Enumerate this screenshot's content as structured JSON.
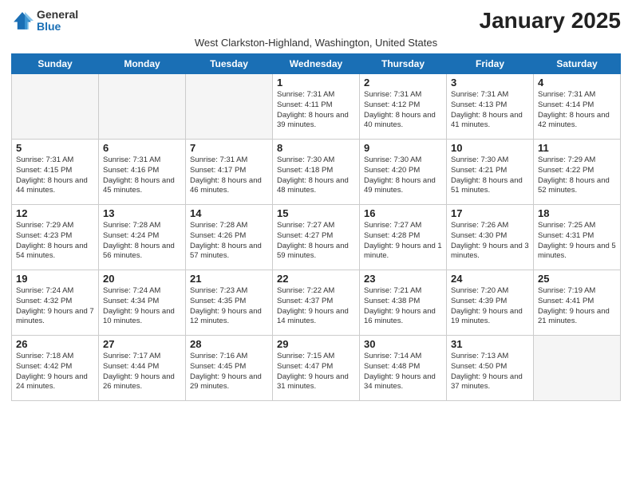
{
  "logo": {
    "general": "General",
    "blue": "Blue"
  },
  "title": "January 2025",
  "subtitle": "West Clarkston-Highland, Washington, United States",
  "headers": [
    "Sunday",
    "Monday",
    "Tuesday",
    "Wednesday",
    "Thursday",
    "Friday",
    "Saturday"
  ],
  "weeks": [
    [
      {
        "day": "",
        "info": ""
      },
      {
        "day": "",
        "info": ""
      },
      {
        "day": "",
        "info": ""
      },
      {
        "day": "1",
        "info": "Sunrise: 7:31 AM\nSunset: 4:11 PM\nDaylight: 8 hours and 39 minutes."
      },
      {
        "day": "2",
        "info": "Sunrise: 7:31 AM\nSunset: 4:12 PM\nDaylight: 8 hours and 40 minutes."
      },
      {
        "day": "3",
        "info": "Sunrise: 7:31 AM\nSunset: 4:13 PM\nDaylight: 8 hours and 41 minutes."
      },
      {
        "day": "4",
        "info": "Sunrise: 7:31 AM\nSunset: 4:14 PM\nDaylight: 8 hours and 42 minutes."
      }
    ],
    [
      {
        "day": "5",
        "info": "Sunrise: 7:31 AM\nSunset: 4:15 PM\nDaylight: 8 hours and 44 minutes."
      },
      {
        "day": "6",
        "info": "Sunrise: 7:31 AM\nSunset: 4:16 PM\nDaylight: 8 hours and 45 minutes."
      },
      {
        "day": "7",
        "info": "Sunrise: 7:31 AM\nSunset: 4:17 PM\nDaylight: 8 hours and 46 minutes."
      },
      {
        "day": "8",
        "info": "Sunrise: 7:30 AM\nSunset: 4:18 PM\nDaylight: 8 hours and 48 minutes."
      },
      {
        "day": "9",
        "info": "Sunrise: 7:30 AM\nSunset: 4:20 PM\nDaylight: 8 hours and 49 minutes."
      },
      {
        "day": "10",
        "info": "Sunrise: 7:30 AM\nSunset: 4:21 PM\nDaylight: 8 hours and 51 minutes."
      },
      {
        "day": "11",
        "info": "Sunrise: 7:29 AM\nSunset: 4:22 PM\nDaylight: 8 hours and 52 minutes."
      }
    ],
    [
      {
        "day": "12",
        "info": "Sunrise: 7:29 AM\nSunset: 4:23 PM\nDaylight: 8 hours and 54 minutes."
      },
      {
        "day": "13",
        "info": "Sunrise: 7:28 AM\nSunset: 4:24 PM\nDaylight: 8 hours and 56 minutes."
      },
      {
        "day": "14",
        "info": "Sunrise: 7:28 AM\nSunset: 4:26 PM\nDaylight: 8 hours and 57 minutes."
      },
      {
        "day": "15",
        "info": "Sunrise: 7:27 AM\nSunset: 4:27 PM\nDaylight: 8 hours and 59 minutes."
      },
      {
        "day": "16",
        "info": "Sunrise: 7:27 AM\nSunset: 4:28 PM\nDaylight: 9 hours and 1 minute."
      },
      {
        "day": "17",
        "info": "Sunrise: 7:26 AM\nSunset: 4:30 PM\nDaylight: 9 hours and 3 minutes."
      },
      {
        "day": "18",
        "info": "Sunrise: 7:25 AM\nSunset: 4:31 PM\nDaylight: 9 hours and 5 minutes."
      }
    ],
    [
      {
        "day": "19",
        "info": "Sunrise: 7:24 AM\nSunset: 4:32 PM\nDaylight: 9 hours and 7 minutes."
      },
      {
        "day": "20",
        "info": "Sunrise: 7:24 AM\nSunset: 4:34 PM\nDaylight: 9 hours and 10 minutes."
      },
      {
        "day": "21",
        "info": "Sunrise: 7:23 AM\nSunset: 4:35 PM\nDaylight: 9 hours and 12 minutes."
      },
      {
        "day": "22",
        "info": "Sunrise: 7:22 AM\nSunset: 4:37 PM\nDaylight: 9 hours and 14 minutes."
      },
      {
        "day": "23",
        "info": "Sunrise: 7:21 AM\nSunset: 4:38 PM\nDaylight: 9 hours and 16 minutes."
      },
      {
        "day": "24",
        "info": "Sunrise: 7:20 AM\nSunset: 4:39 PM\nDaylight: 9 hours and 19 minutes."
      },
      {
        "day": "25",
        "info": "Sunrise: 7:19 AM\nSunset: 4:41 PM\nDaylight: 9 hours and 21 minutes."
      }
    ],
    [
      {
        "day": "26",
        "info": "Sunrise: 7:18 AM\nSunset: 4:42 PM\nDaylight: 9 hours and 24 minutes."
      },
      {
        "day": "27",
        "info": "Sunrise: 7:17 AM\nSunset: 4:44 PM\nDaylight: 9 hours and 26 minutes."
      },
      {
        "day": "28",
        "info": "Sunrise: 7:16 AM\nSunset: 4:45 PM\nDaylight: 9 hours and 29 minutes."
      },
      {
        "day": "29",
        "info": "Sunrise: 7:15 AM\nSunset: 4:47 PM\nDaylight: 9 hours and 31 minutes."
      },
      {
        "day": "30",
        "info": "Sunrise: 7:14 AM\nSunset: 4:48 PM\nDaylight: 9 hours and 34 minutes."
      },
      {
        "day": "31",
        "info": "Sunrise: 7:13 AM\nSunset: 4:50 PM\nDaylight: 9 hours and 37 minutes."
      },
      {
        "day": "",
        "info": ""
      }
    ]
  ]
}
